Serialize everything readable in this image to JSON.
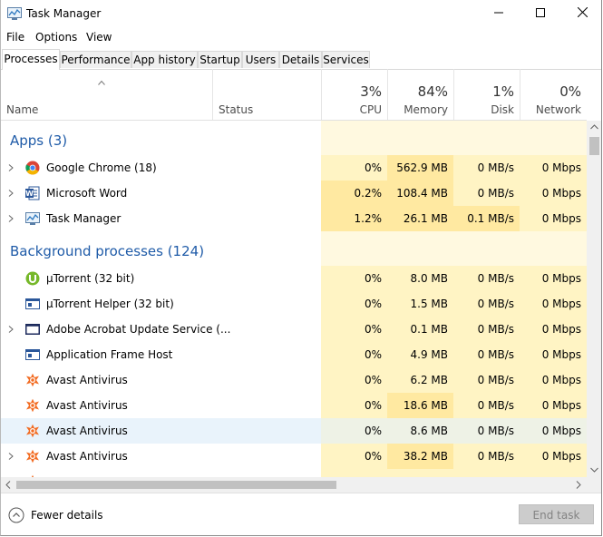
{
  "window": {
    "title": "Task Manager"
  },
  "menu": [
    "File",
    "Options",
    "View"
  ],
  "tabs": [
    "Processes",
    "Performance",
    "App history",
    "Startup",
    "Users",
    "Details",
    "Services"
  ],
  "header": {
    "name": "Name",
    "status": "Status",
    "cpu": {
      "pct": "3%",
      "label": "CPU"
    },
    "memory": {
      "pct": "84%",
      "label": "Memory"
    },
    "disk": {
      "pct": "1%",
      "label": "Disk"
    },
    "network": {
      "pct": "0%",
      "label": "Network"
    }
  },
  "groups": {
    "apps": "Apps (3)",
    "background": "Background processes (124)"
  },
  "apps": [
    {
      "name": "Google Chrome (18)",
      "cpu": "0%",
      "memory": "562.9 MB",
      "disk": "0 MB/s",
      "network": "0 Mbps"
    },
    {
      "name": "Microsoft Word",
      "cpu": "0.2%",
      "memory": "108.4 MB",
      "disk": "0 MB/s",
      "network": "0 Mbps"
    },
    {
      "name": "Task Manager",
      "cpu": "1.2%",
      "memory": "26.1 MB",
      "disk": "0.1 MB/s",
      "network": "0 Mbps"
    }
  ],
  "background": [
    {
      "name": "μTorrent (32 bit)",
      "cpu": "0%",
      "memory": "8.0 MB",
      "disk": "0 MB/s",
      "network": "0 Mbps"
    },
    {
      "name": "μTorrent Helper (32 bit)",
      "cpu": "0%",
      "memory": "1.5 MB",
      "disk": "0 MB/s",
      "network": "0 Mbps"
    },
    {
      "name": "Adobe Acrobat Update Service (...",
      "cpu": "0%",
      "memory": "0.1 MB",
      "disk": "0 MB/s",
      "network": "0 Mbps"
    },
    {
      "name": "Application Frame Host",
      "cpu": "0%",
      "memory": "4.9 MB",
      "disk": "0 MB/s",
      "network": "0 Mbps"
    },
    {
      "name": "Avast Antivirus",
      "cpu": "0%",
      "memory": "6.2 MB",
      "disk": "0 MB/s",
      "network": "0 Mbps"
    },
    {
      "name": "Avast Antivirus",
      "cpu": "0%",
      "memory": "18.6 MB",
      "disk": "0 MB/s",
      "network": "0 Mbps"
    },
    {
      "name": "Avast Antivirus",
      "cpu": "0%",
      "memory": "8.6 MB",
      "disk": "0 MB/s",
      "network": "0 Mbps"
    },
    {
      "name": "Avast Antivirus",
      "cpu": "0%",
      "memory": "38.2 MB",
      "disk": "0 MB/s",
      "network": "0 Mbps"
    }
  ],
  "footer": {
    "fewer_details": "Fewer details",
    "end_task": "End task"
  },
  "colors": {
    "group_heading": "#1f5ba8",
    "heat_low": "#fff4c4",
    "heat_high": "#ffe9a1"
  }
}
